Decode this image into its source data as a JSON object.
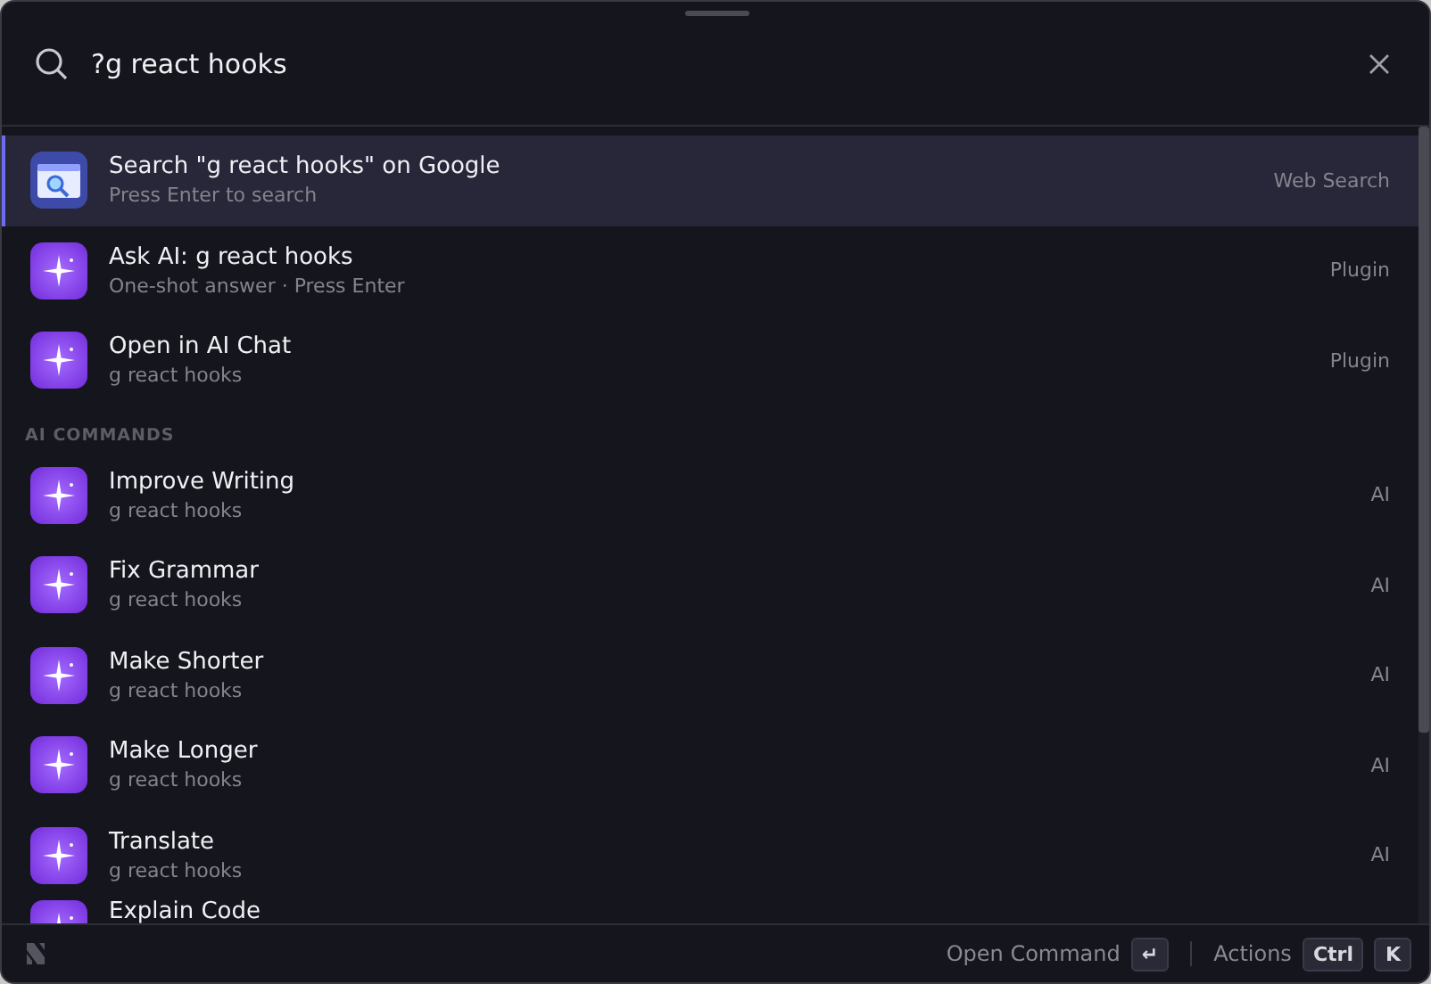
{
  "search": {
    "value": "?g react hooks"
  },
  "results": [
    {
      "kind": "web",
      "title": "Search \"g react hooks\" on Google",
      "subtitle": "Press Enter to search",
      "tag": "Web Search",
      "selected": true
    },
    {
      "kind": "ai",
      "title": "Ask AI: g react hooks",
      "subtitle": "One-shot answer · Press Enter",
      "tag": "Plugin",
      "selected": false
    },
    {
      "kind": "ai",
      "title": "Open in AI Chat",
      "subtitle": "g react hooks",
      "tag": "Plugin",
      "selected": false
    }
  ],
  "sections": [
    {
      "header": "AI COMMANDS",
      "items": [
        {
          "kind": "ai",
          "title": "Improve Writing",
          "subtitle": "g react hooks",
          "tag": "AI",
          "selected": false
        },
        {
          "kind": "ai",
          "title": "Fix Grammar",
          "subtitle": "g react hooks",
          "tag": "AI",
          "selected": false
        },
        {
          "kind": "ai",
          "title": "Make Shorter",
          "subtitle": "g react hooks",
          "tag": "AI",
          "selected": false
        },
        {
          "kind": "ai",
          "title": "Make Longer",
          "subtitle": "g react hooks",
          "tag": "AI",
          "selected": false
        },
        {
          "kind": "ai",
          "title": "Translate",
          "subtitle": "g react hooks",
          "tag": "AI",
          "selected": false
        },
        {
          "kind": "ai",
          "title": "Explain Code",
          "selected": false
        }
      ]
    }
  ],
  "footer": {
    "open_label": "Open Command",
    "open_key": "↵",
    "actions_label": "Actions",
    "action_keys": [
      "Ctrl",
      "K"
    ]
  }
}
